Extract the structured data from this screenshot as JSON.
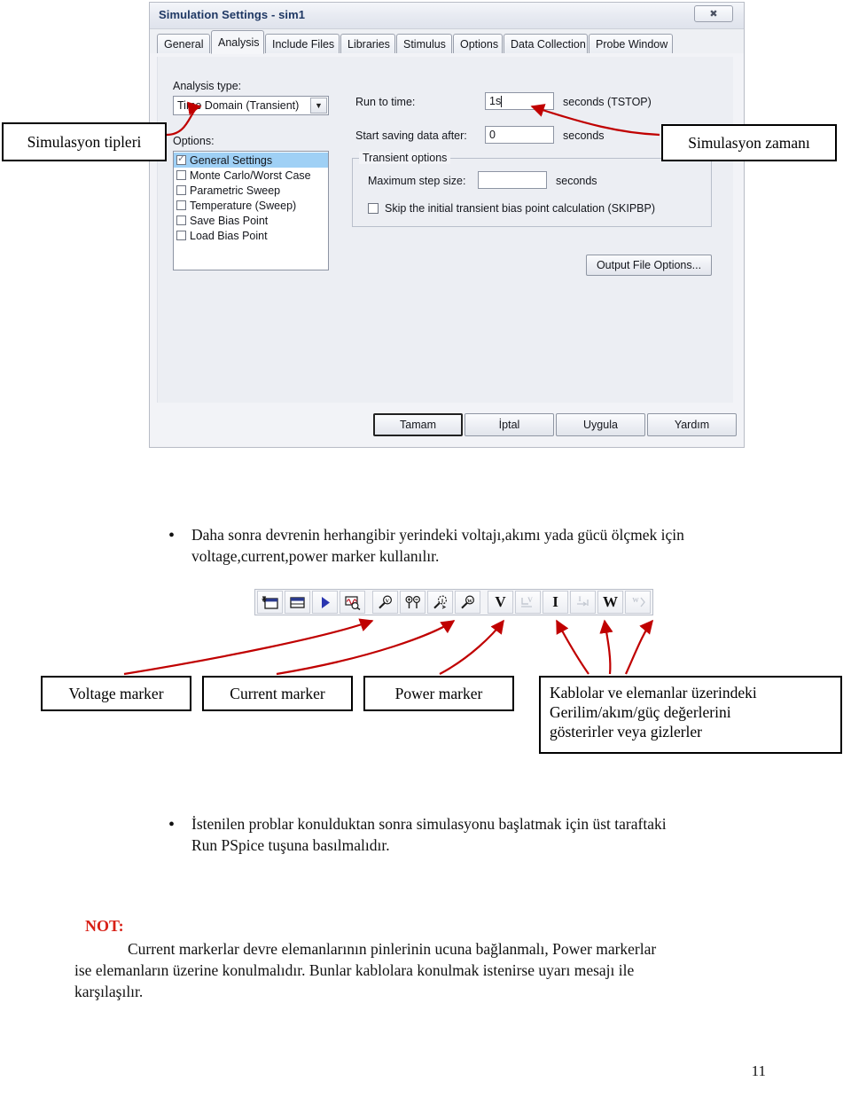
{
  "dialog": {
    "title": "Simulation Settings - sim1",
    "close_icon": "close-icon",
    "tabs": [
      {
        "label": "General",
        "active": false
      },
      {
        "label": "Analysis",
        "active": true
      },
      {
        "label": "Include Files",
        "active": false
      },
      {
        "label": "Libraries",
        "active": false
      },
      {
        "label": "Stimulus",
        "active": false
      },
      {
        "label": "Options",
        "active": false
      },
      {
        "label": "Data Collection",
        "active": false
      },
      {
        "label": "Probe Window",
        "active": false
      }
    ],
    "analysis_type_label": "Analysis type:",
    "analysis_type_value": "Time Domain (Transient)",
    "options_label": "Options:",
    "options": [
      {
        "label": "General Settings",
        "checked": true,
        "selected": true
      },
      {
        "label": "Monte Carlo/Worst Case",
        "checked": false,
        "selected": false
      },
      {
        "label": "Parametric Sweep",
        "checked": false,
        "selected": false
      },
      {
        "label": "Temperature (Sweep)",
        "checked": false,
        "selected": false
      },
      {
        "label": "Save Bias Point",
        "checked": false,
        "selected": false
      },
      {
        "label": "Load Bias Point",
        "checked": false,
        "selected": false
      }
    ],
    "run_to_time_label": "Run to time:",
    "run_to_time_value": "1s",
    "run_to_time_units": "seconds  (TSTOP)",
    "start_saving_label": "Start saving data after:",
    "start_saving_value": "0",
    "start_saving_units": "seconds",
    "transient_group_title": "Transient options",
    "max_step_label": "Maximum step size:",
    "max_step_value": "",
    "max_step_units": "seconds",
    "skipbp_label": "Skip the initial transient bias point calculation  (SKIPBP)",
    "skipbp_checked": false,
    "output_file_options": "Output File Options...",
    "buttons": [
      {
        "label": "Tamam",
        "default": true
      },
      {
        "label": "İptal",
        "default": false
      },
      {
        "label": "Uygula",
        "default": false
      },
      {
        "label": "Yardım",
        "default": false
      }
    ]
  },
  "callouts": {
    "sim_types": "Simulasyon tipleri",
    "sim_time": "Simulasyon zamanı",
    "voltage_marker": "Voltage marker",
    "current_marker": "Current marker",
    "power_marker": "Power marker",
    "wires_line1": "Kablolar ve elemanlar üzerindeki",
    "wires_line2": "Gerilim/akım/güç değerlerini",
    "wires_line3": "gösterirler veya gizlerler"
  },
  "body": {
    "bullet1_line1": "Daha sonra devrenin herhangibir yerindeki voltajı,akımı yada gücü ölçmek için",
    "bullet1_line2": "voltage,current,power marker kullanılır.",
    "bullet2_line1": "İstenilen problar konulduktan sonra simulasyonu başlatmak için üst taraftaki",
    "bullet2_line2": "Run PSpice tuşuna basılmalıdır.",
    "note_label": "NOT:",
    "note_line1": "Current markerlar devre elemanlarının pinlerinin ucuna bağlanmalı, Power markerlar",
    "note_line2": "ise elemanların üzerine konulmalıdır. Bunlar kablolara konulmak istenirse uyarı mesajı ile",
    "note_line3": "karşılaşılır.",
    "page_number": "11"
  },
  "toolbar": {
    "buttons": [
      {
        "icon": "new-simulation-profile-icon",
        "label": "",
        "disabled": false
      },
      {
        "icon": "edit-simulation-profile-icon",
        "label": "",
        "disabled": false
      },
      {
        "icon": "run-pspice-icon",
        "label": "",
        "disabled": false
      },
      {
        "icon": "view-simulation-results-icon",
        "label": "",
        "disabled": false
      },
      {
        "icon": "voltage-level-marker-icon",
        "label": "",
        "disabled": false
      },
      {
        "icon": "voltage-differential-marker-icon",
        "label": "",
        "disabled": false
      },
      {
        "icon": "current-marker-icon",
        "label": "",
        "disabled": false
      },
      {
        "icon": "power-marker-icon",
        "label": "",
        "disabled": false
      },
      {
        "icon": "enable-voltage-display-icon",
        "label": "V",
        "disabled": false
      },
      {
        "icon": "disable-voltage-display-icon",
        "label": "",
        "disabled": true
      },
      {
        "icon": "enable-current-display-icon",
        "label": "I",
        "disabled": false
      },
      {
        "icon": "disable-current-display-icon",
        "label": "",
        "disabled": true
      },
      {
        "icon": "enable-power-display-icon",
        "label": "W",
        "disabled": false
      },
      {
        "icon": "disable-power-display-icon",
        "label": "",
        "disabled": true
      }
    ]
  },
  "colors": {
    "arrow_red": "#c00000",
    "note_red": "#d81f16",
    "title_blue": "#1f3864",
    "selection_blue": "#9fd0f5"
  }
}
